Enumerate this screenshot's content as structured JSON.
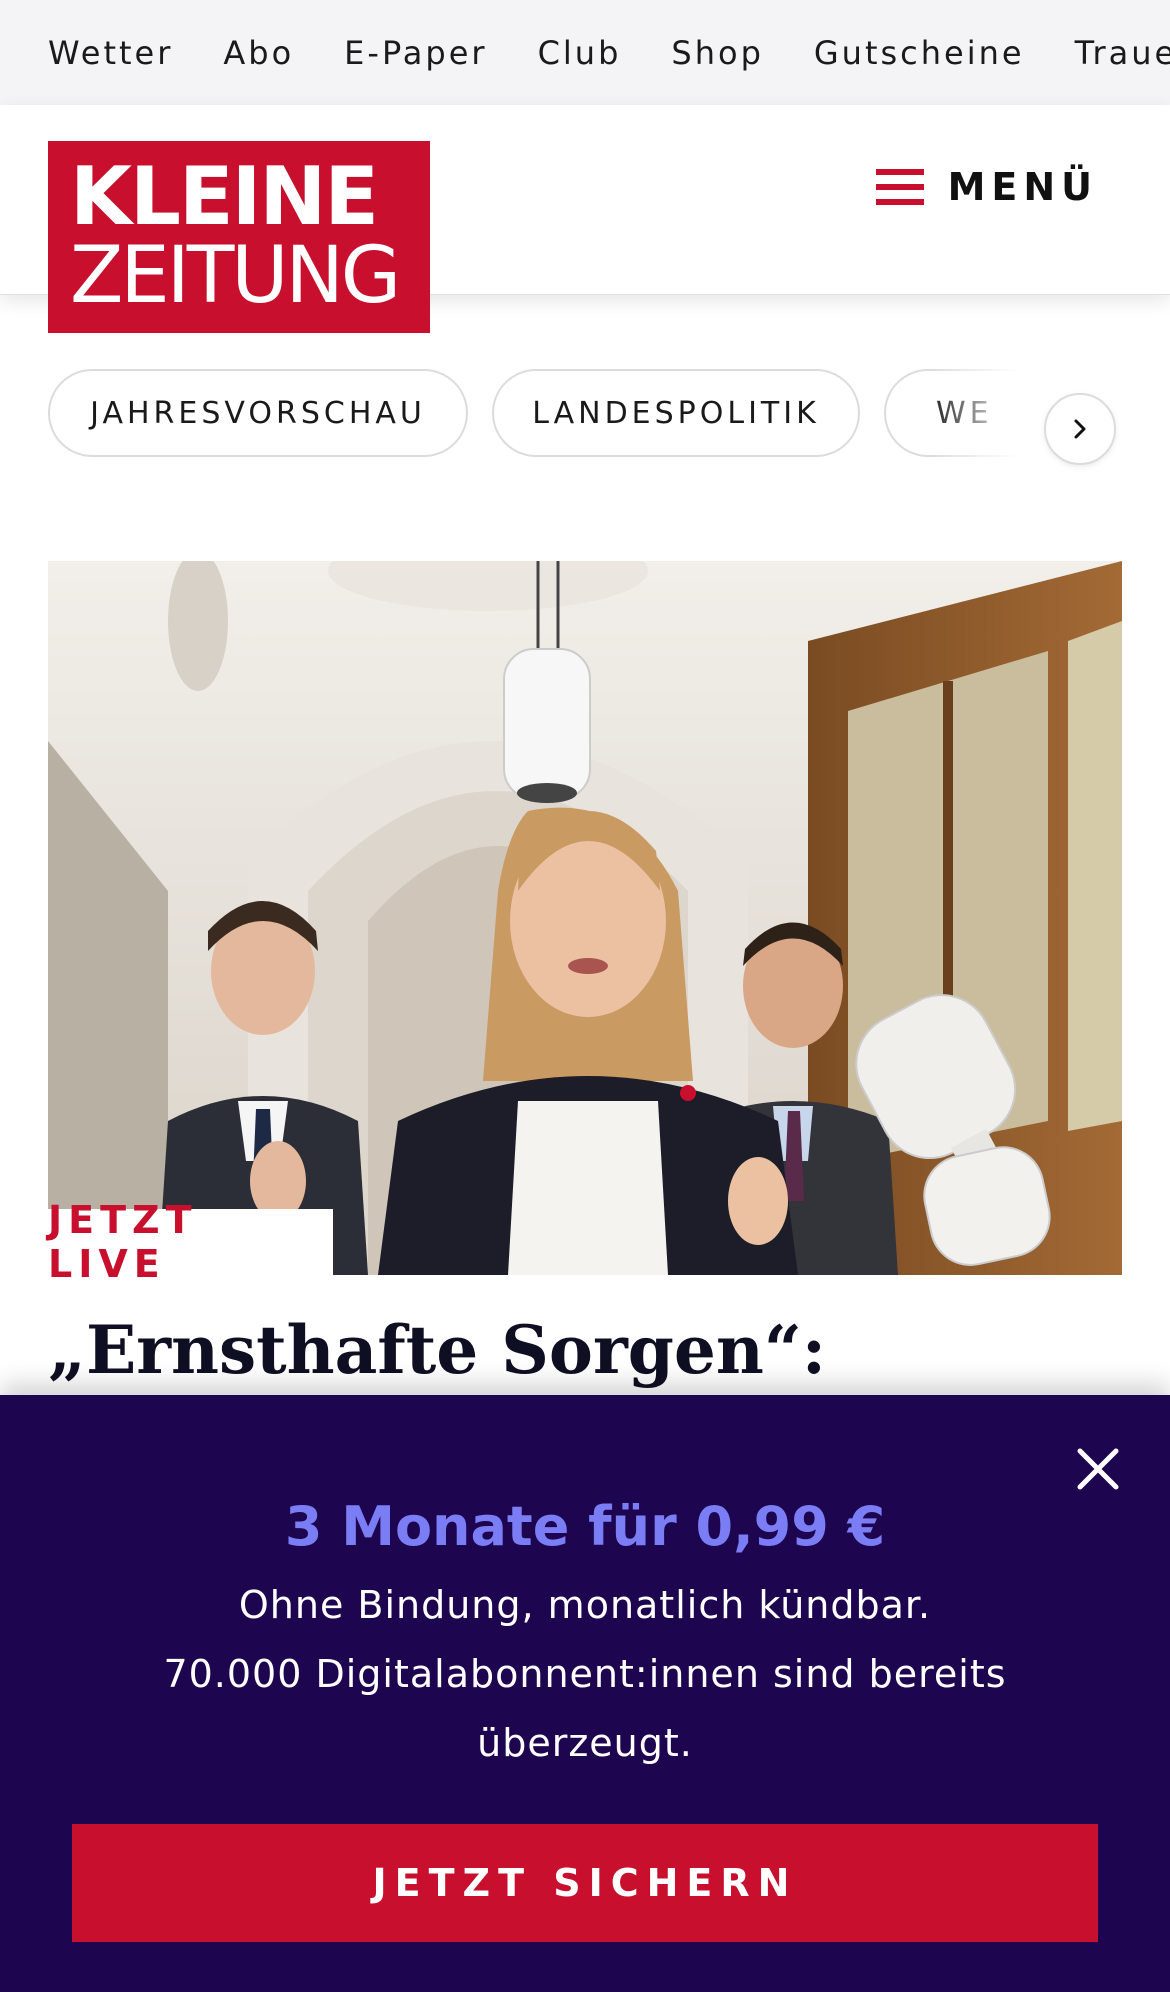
{
  "topbar": {
    "links": [
      "Wetter",
      "Abo",
      "E-Paper",
      "Club",
      "Shop",
      "Gutscheine",
      "Trauerp"
    ]
  },
  "header": {
    "logo_line1": "KLEINE",
    "logo_line2": "ZEITUNG",
    "menu_label": "MENÜ"
  },
  "categories": {
    "chips": [
      "JAHRESVORSCHAU",
      "LANDESPOLITIK",
      "WE"
    ]
  },
  "article": {
    "badge": "JETZT LIVE",
    "headline": "„Ernsthafte Sorgen“:"
  },
  "promo": {
    "title": "3 Monate für 0,99 €",
    "line1": "Ohne Bindung, monatlich kündbar.",
    "line2": "70.000 Digitalabonnent:innen sind bereits",
    "line3": "überzeugt.",
    "cta": "JETZT SICHERN"
  },
  "colors": {
    "brand_red": "#c8102e",
    "promo_bg": "#1d0550",
    "promo_accent": "#7b7df5"
  }
}
